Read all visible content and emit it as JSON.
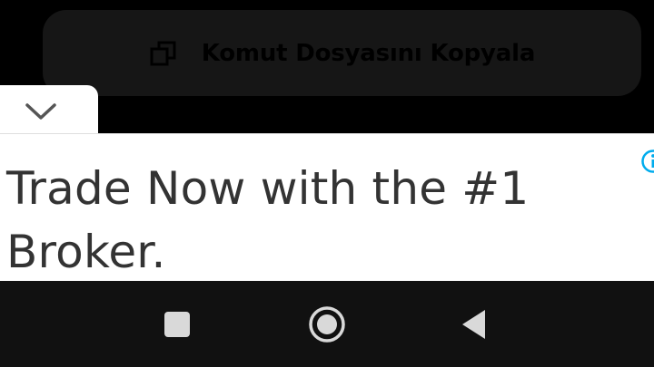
{
  "copy_button": {
    "label": "Komut Dosyasını Kopyala",
    "icon": "copy-icon"
  },
  "collapse_tab": {
    "icon": "chevron-down-icon"
  },
  "ad": {
    "headline": "Trade Now with the #1 Broker.",
    "info_icon": "info-icon",
    "accent_color": "#00aced"
  },
  "nav_bar": {
    "recents_icon": "square-recents-icon",
    "home_icon": "circle-home-icon",
    "back_icon": "triangle-back-icon"
  },
  "colors": {
    "background": "#000000",
    "button_bg": "#161616",
    "banner_bg": "#ffffff",
    "headline_text": "#333333",
    "nav_bg": "#111111",
    "nav_icon": "#d9d9d9"
  }
}
